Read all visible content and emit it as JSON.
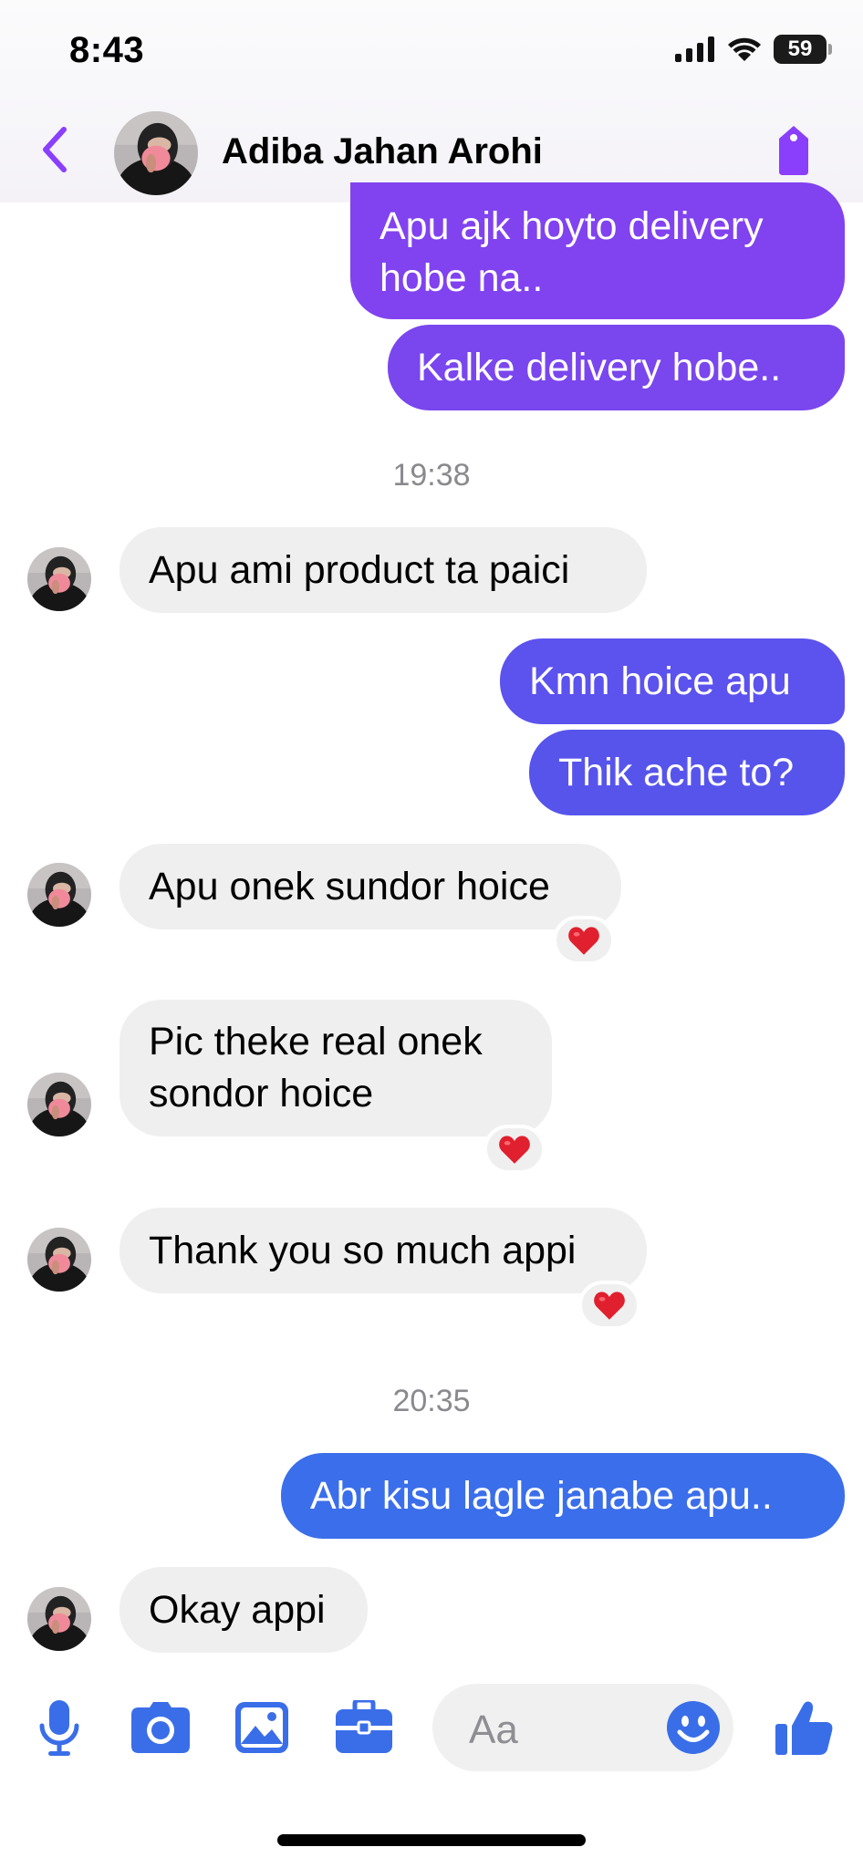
{
  "status_bar": {
    "time": "8:43",
    "battery": "59"
  },
  "header": {
    "contact_name": "Adiba Jahan Arohi"
  },
  "colors": {
    "accent": "#8a3ffc",
    "outgoing_purple": "#7a46ee",
    "outgoing_blue": "#3b6eea",
    "incoming": "#efefef",
    "reaction_heart": "#e0202e"
  },
  "messages": [
    {
      "direction": "outgoing",
      "text": "Apu ajk hoyto delivery hobe na.."
    },
    {
      "direction": "outgoing",
      "text": "Kalke delivery hobe.."
    },
    {
      "type": "timestamp",
      "text": "19:38"
    },
    {
      "direction": "incoming",
      "text": "Apu ami product ta paici"
    },
    {
      "direction": "outgoing",
      "text": "Kmn hoice apu"
    },
    {
      "direction": "outgoing",
      "text": "Thik ache to?"
    },
    {
      "direction": "incoming",
      "text": "Apu onek sundor hoice",
      "reaction": "heart"
    },
    {
      "direction": "incoming",
      "text": "Pic theke real onek sondor hoice",
      "reaction": "heart"
    },
    {
      "direction": "incoming",
      "text": "Thank you so much appi",
      "reaction": "heart"
    },
    {
      "type": "timestamp",
      "text": "20:35"
    },
    {
      "direction": "outgoing",
      "text": "Abr kisu lagle janabe apu.."
    },
    {
      "direction": "incoming",
      "text": "Okay appi"
    }
  ],
  "composer": {
    "placeholder": "Aa",
    "icons": [
      "microphone-icon",
      "camera-icon",
      "image-icon",
      "briefcase-icon",
      "emoji-icon",
      "thumbs-up-icon"
    ]
  }
}
